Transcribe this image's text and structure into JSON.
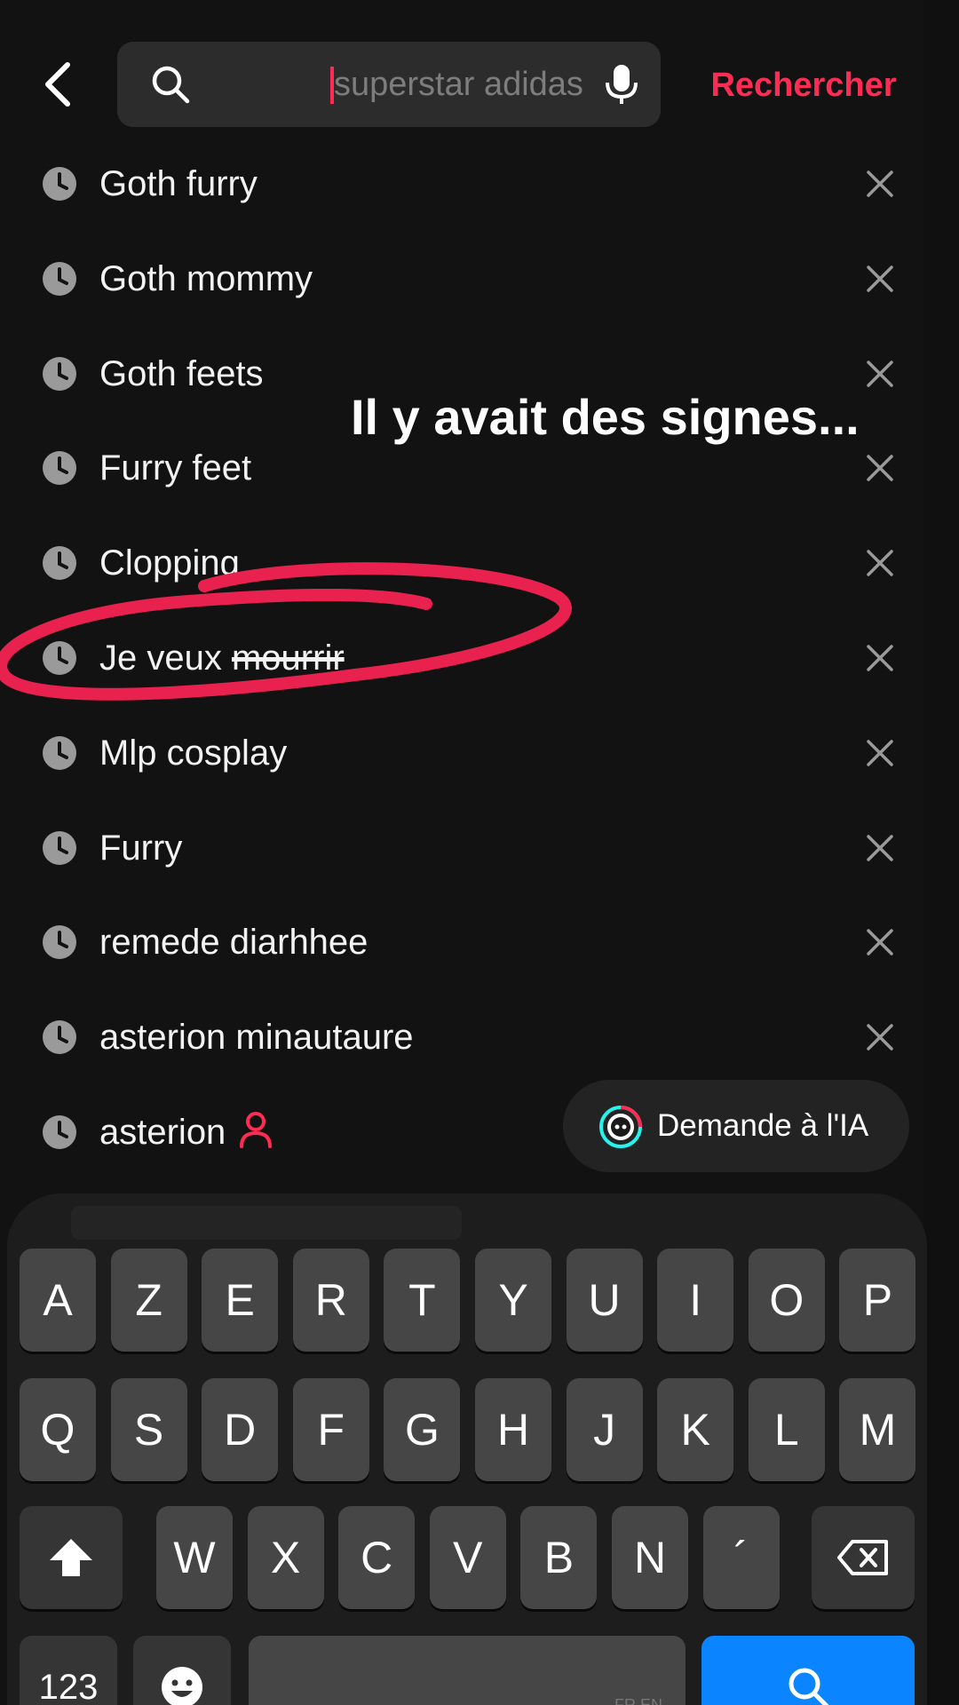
{
  "colors": {
    "accent": "#fe2c55",
    "background": "#121212",
    "search_bg": "#2c2c2c",
    "key_bg": "#464646",
    "key_blue": "#0a84ff"
  },
  "header": {
    "back_icon": "chevron-left-icon",
    "search_placeholder": "superstar adidas",
    "search_value": "",
    "search_icon": "search-icon",
    "mic_icon": "microphone-icon",
    "submit_label": "Rechercher"
  },
  "history": {
    "items": [
      {
        "label": "Goth furry"
      },
      {
        "label": "Goth mommy"
      },
      {
        "label": "Goth feets"
      },
      {
        "label": "Furry feet"
      },
      {
        "label": "Clopping"
      },
      {
        "label": "Je veux",
        "struck": "mourrir"
      },
      {
        "label": "Mlp cosplay"
      },
      {
        "label": "Furry"
      },
      {
        "label": "remede diarhhee"
      },
      {
        "label": "asterion minautaure"
      },
      {
        "label": "asterion"
      }
    ]
  },
  "overlay": {
    "caption": "Il y avait des signes..."
  },
  "ai_pill": {
    "label": "Demande à l'IA"
  },
  "keyboard": {
    "row1": [
      "A",
      "Z",
      "E",
      "R",
      "T",
      "Y",
      "U",
      "I",
      "O",
      "P"
    ],
    "row2": [
      "Q",
      "S",
      "D",
      "F",
      "G",
      "H",
      "J",
      "K",
      "L",
      "M"
    ],
    "row3": [
      "W",
      "X",
      "C",
      "V",
      "B",
      "N",
      "´"
    ],
    "numbers_label": "123",
    "layout_hint": "FR EN"
  }
}
